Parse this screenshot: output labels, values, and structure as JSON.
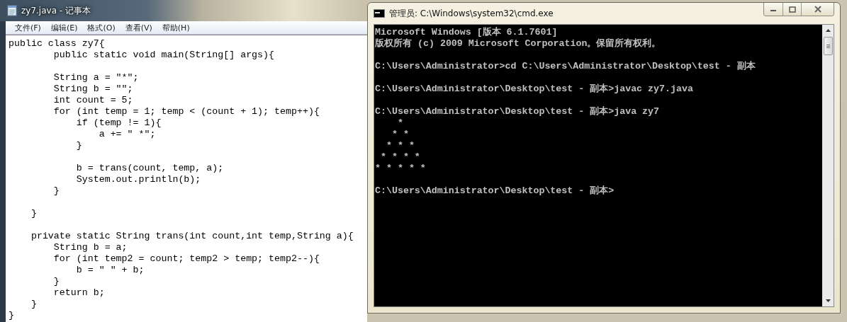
{
  "notepad": {
    "title": "zy7.java - 记事本",
    "menu": [
      "文件(F)",
      "编辑(E)",
      "格式(O)",
      "查看(V)",
      "帮助(H)"
    ],
    "content": "public class zy7{\n\tpublic static void main(String[] args){\n\n\tString a = \"*\";\n\tString b = \"\";\n\tint count = 5;\n\tfor (int temp = 1; temp < (count + 1); temp++){\n\t    if (temp != 1){\n\t\ta += \" *\";\n\t    }\n\n\t    b = trans(count, temp, a);\n\t    System.out.println(b);\n\t}\n\n    }\n\n    private static String trans(int count,int temp,String a){\n\tString b = a;\n\tfor (int temp2 = count; temp2 > temp; temp2--){\n\t    b = \" \" + b;\n\t}\n\treturn b;\n    }\n}"
  },
  "console": {
    "title": "管理员: C:\\Windows\\system32\\cmd.exe",
    "output": "Microsoft Windows [版本 6.1.7601]\n版权所有 (c) 2009 Microsoft Corporation。保留所有权利。\n\nC:\\Users\\Administrator>cd C:\\Users\\Administrator\\Desktop\\test - 副本\n\nC:\\Users\\Administrator\\Desktop\\test - 副本>javac zy7.java\n\nC:\\Users\\Administrator\\Desktop\\test - 副本>java zy7\n    *\n   * *\n  * * *\n * * * *\n* * * * *\n\nC:\\Users\\Administrator\\Desktop\\test - 副本>"
  }
}
